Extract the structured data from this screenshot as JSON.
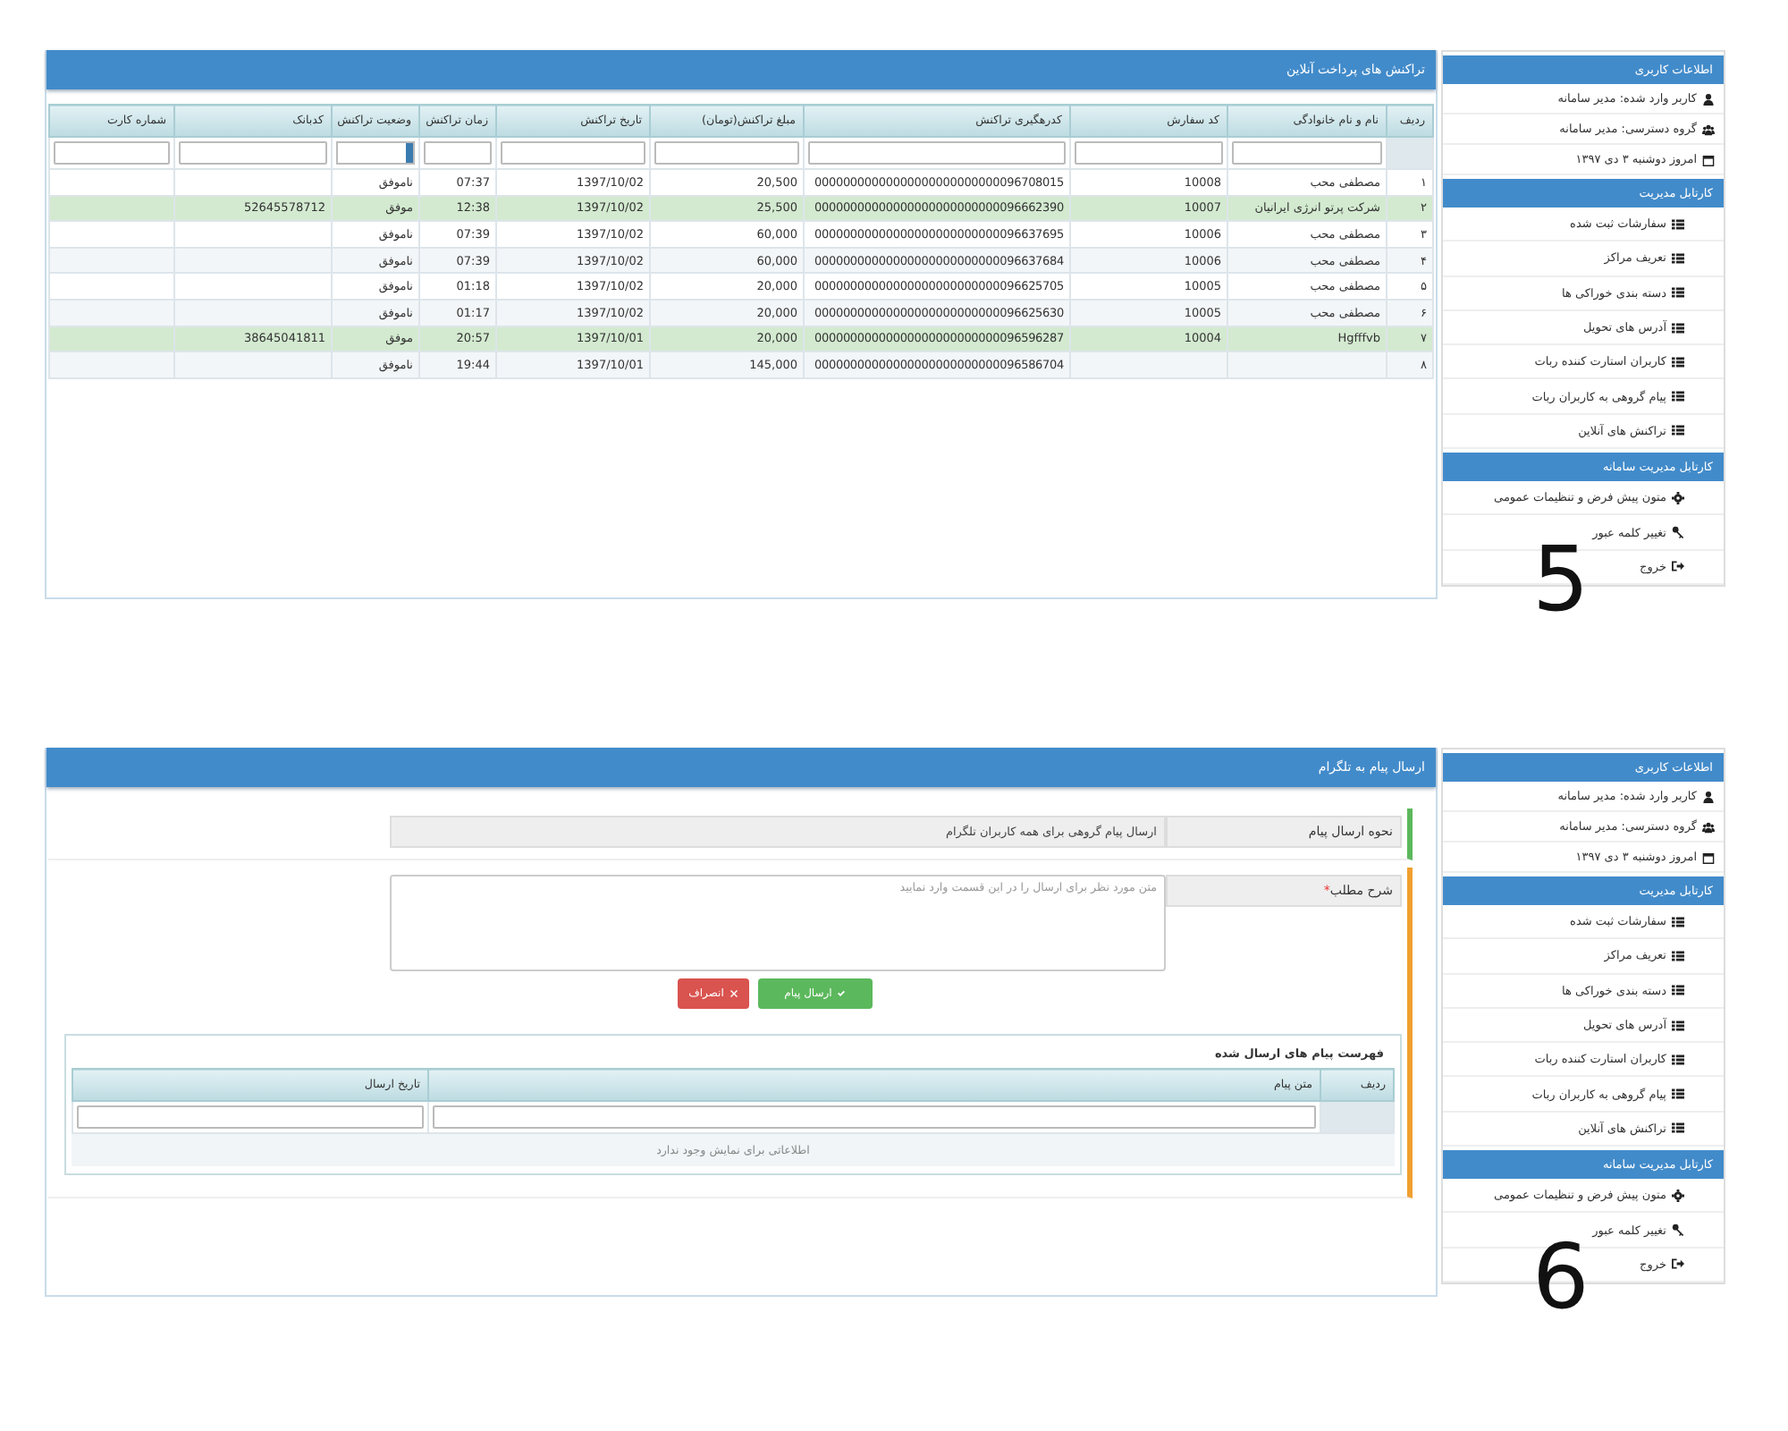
{
  "panels": [
    {
      "figure_label": "5",
      "sidebar": {
        "sections": [
          {
            "title": "اطلاعات کاربری",
            "kind": "info",
            "items": [
              {
                "kind": "user",
                "label": "کاربر وارد شده: مدیر سامانه"
              },
              {
                "kind": "group",
                "label": "گروه دسترسی: مدیر سامانه"
              },
              {
                "kind": "calendar",
                "label": "امروز دوشنبه ۳ دی ۱۳۹۷"
              }
            ]
          },
          {
            "title": "کارتابل مدیریت",
            "kind": "nav",
            "items": [
              {
                "kind": "list",
                "label": "سفارشات ثبت شده"
              },
              {
                "kind": "list",
                "label": "تعریف مراکز"
              },
              {
                "kind": "list",
                "label": "دسته بندی خوراکی ها"
              },
              {
                "kind": "list",
                "label": "آدرس های تحویل"
              },
              {
                "kind": "list",
                "label": "کاربران استارت کننده ربات"
              },
              {
                "kind": "list",
                "label": "پیام گروهی به کاربران ربات"
              },
              {
                "kind": "list",
                "label": "تراکنش های آنلاین"
              }
            ]
          },
          {
            "title": "کارتابل مدیریت سامانه",
            "kind": "nav",
            "items": [
              {
                "kind": "settings",
                "label": "متون پیش فرض و تنظیمات عمومی"
              },
              {
                "kind": "key",
                "label": "تغییر کلمه عبور"
              },
              {
                "kind": "logout",
                "label": "خروج"
              }
            ]
          }
        ]
      },
      "main": {
        "kind": "transactions",
        "title": "تراکنش های پرداخت آنلاین",
        "table": {
          "columns": [
            {
              "label": "ردیف",
              "kind": "none"
            },
            {
              "label": "نام و نام خانوادگی",
              "kind": "text"
            },
            {
              "label": "کد سفارش",
              "kind": "text"
            },
            {
              "label": "کدرهگیری تراکنش",
              "kind": "text"
            },
            {
              "label": "مبلغ تراکنش(تومان)",
              "kind": "text"
            },
            {
              "label": "تاریخ تراکنش",
              "kind": "text"
            },
            {
              "label": "زمان تراکنش",
              "kind": "text"
            },
            {
              "label": "وضعیت تراکنش",
              "kind": "select"
            },
            {
              "label": "کدبانک",
              "kind": "text"
            },
            {
              "label": "شماره کارت",
              "kind": "text"
            }
          ],
          "rows": [
            {
              "highlighted": false,
              "cells": [
                "۱",
                "مصطفی محب",
                "10008",
                "00000000000000000000000000096708015",
                "20,500",
                "1397/10/02",
                "07:37",
                "ناموفق",
                null,
                null
              ]
            },
            {
              "highlighted": true,
              "cells": [
                "۲",
                "شرکت پرتو انرژی ایرانیان",
                "10007",
                "00000000000000000000000000096662390",
                "25,500",
                "1397/10/02",
                "12:38",
                "موفق",
                "52645578712",
                null
              ]
            },
            {
              "highlighted": false,
              "cells": [
                "۳",
                "مصطفی محب",
                "10006",
                "00000000000000000000000000096637695",
                "60,000",
                "1397/10/02",
                "07:39",
                "ناموفق",
                null,
                null
              ]
            },
            {
              "highlighted": false,
              "cells": [
                "۴",
                "مصطفی محب",
                "10006",
                "00000000000000000000000000096637684",
                "60,000",
                "1397/10/02",
                "07:39",
                "ناموفق",
                null,
                null
              ]
            },
            {
              "highlighted": false,
              "cells": [
                "۵",
                "مصطفی محب",
                "10005",
                "00000000000000000000000000096625705",
                "20,000",
                "1397/10/02",
                "01:18",
                "ناموفق",
                null,
                null
              ]
            },
            {
              "highlighted": false,
              "cells": [
                "۶",
                "مصطفی محب",
                "10005",
                "00000000000000000000000000096625630",
                "20,000",
                "1397/10/02",
                "01:17",
                "ناموفق",
                null,
                null
              ]
            },
            {
              "highlighted": true,
              "cells": [
                "۷",
                "Hgfffvb",
                "10004",
                "00000000000000000000000000096596287",
                "20,000",
                "1397/10/01",
                "20:57",
                "موفق",
                "38645041811",
                null
              ]
            },
            {
              "highlighted": false,
              "cells": [
                "۸",
                null,
                null,
                "00000000000000000000000000096586704",
                "145,000",
                "1397/10/01",
                "19:44",
                "ناموفق",
                null,
                null
              ]
            }
          ]
        }
      }
    },
    {
      "figure_label": "6",
      "sidebar": {
        "sections": [
          {
            "title": "اطلاعات کاربری",
            "kind": "info",
            "items": [
              {
                "kind": "user",
                "label": "کاربر وارد شده: مدیر سامانه"
              },
              {
                "kind": "group",
                "label": "گروه دسترسی: مدیر سامانه"
              },
              {
                "kind": "calendar",
                "label": "امروز دوشنبه ۳ دی ۱۳۹۷"
              }
            ]
          },
          {
            "title": "کارتابل مدیریت",
            "kind": "nav",
            "items": [
              {
                "kind": "list",
                "label": "سفارشات ثبت شده"
              },
              {
                "kind": "list",
                "label": "تعریف مراکز"
              },
              {
                "kind": "list",
                "label": "دسته بندی خوراکی ها"
              },
              {
                "kind": "list",
                "label": "آدرس های تحویل"
              },
              {
                "kind": "list",
                "label": "کاربران استارت کننده ربات"
              },
              {
                "kind": "list",
                "label": "پیام گروهی به کاربران ربات"
              },
              {
                "kind": "list",
                "label": "تراکنش های آنلاین"
              }
            ]
          },
          {
            "title": "کارتابل مدیریت سامانه",
            "kind": "nav",
            "items": [
              {
                "kind": "settings",
                "label": "متون پیش فرض و تنظیمات عمومی"
              },
              {
                "kind": "key",
                "label": "تغییر کلمه عبور"
              },
              {
                "kind": "logout",
                "label": "خروج"
              }
            ]
          }
        ]
      },
      "main": {
        "kind": "message_form",
        "title": "ارسال پیام به تلگرام",
        "send_mode": {
          "label": "نحوه ارسال پیام",
          "value": "ارسال پیام گروهی برای همه کاربران تلگرام",
          "kind": "success"
        },
        "description": {
          "label": "شرح مطلب",
          "required_mark": "*",
          "placeholder": "متن مورد نظر برای ارسال را در این قسمت وارد نمایید",
          "kind": "warning"
        },
        "buttons": [
          {
            "kind": "submit",
            "label": "ارسال پیام"
          },
          {
            "kind": "cancel",
            "label": "انصراف"
          }
        ],
        "sent_list": {
          "title": "فهرست پیام های ارسال شده",
          "columns": [
            {
              "label": "ردیف",
              "kind": "none"
            },
            {
              "label": "متن پیام",
              "kind": "text"
            },
            {
              "label": "تاریخ ارسال",
              "kind": "text"
            }
          ],
          "empty_text": "اطلاعاتی برای نمایش وجود ندارد"
        }
      }
    }
  ]
}
